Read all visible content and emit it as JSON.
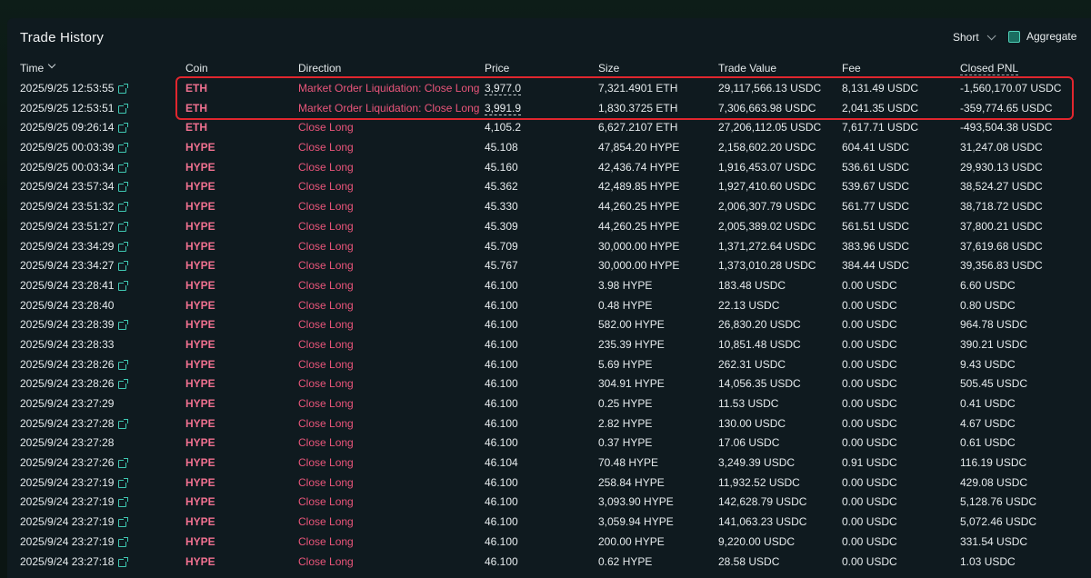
{
  "panel": {
    "title": "Trade History",
    "short_label": "Short",
    "aggregate_label": "Aggregate"
  },
  "columns": {
    "time": "Time",
    "coin": "Coin",
    "direction": "Direction",
    "price": "Price",
    "size": "Size",
    "trade_value": "Trade Value",
    "fee": "Fee",
    "closed_pnl": "Closed PNL"
  },
  "colors": {
    "accent": "#3fc8b2",
    "coin_text": "#f07190",
    "direction_text": "#e9557a",
    "highlight_border": "#e1262e"
  },
  "rows": [
    {
      "time": "2025/9/25 12:53:55",
      "link": true,
      "coin": "ETH",
      "direction": "Market Order Liquidation: Close Long",
      "price": "3,977.0",
      "size": "7,321.4901 ETH",
      "trade_value": "29,117,566.13 USDC",
      "fee": "8,131.49 USDC",
      "pnl": "-1,560,170.07 USDC"
    },
    {
      "time": "2025/9/25 12:53:51",
      "link": true,
      "coin": "ETH",
      "direction": "Market Order Liquidation: Close Long",
      "price": "3,991.9",
      "size": "1,830.3725 ETH",
      "trade_value": "7,306,663.98 USDC",
      "fee": "2,041.35 USDC",
      "pnl": "-359,774.65 USDC"
    },
    {
      "time": "2025/9/25 09:26:14",
      "link": true,
      "coin": "ETH",
      "direction": "Close Long",
      "price": "4,105.2",
      "size": "6,627.2107 ETH",
      "trade_value": "27,206,112.05 USDC",
      "fee": "7,617.71 USDC",
      "pnl": "-493,504.38 USDC"
    },
    {
      "time": "2025/9/25 00:03:39",
      "link": true,
      "coin": "HYPE",
      "direction": "Close Long",
      "price": "45.108",
      "size": "47,854.20 HYPE",
      "trade_value": "2,158,602.20 USDC",
      "fee": "604.41 USDC",
      "pnl": "31,247.08 USDC"
    },
    {
      "time": "2025/9/25 00:03:34",
      "link": true,
      "coin": "HYPE",
      "direction": "Close Long",
      "price": "45.160",
      "size": "42,436.74 HYPE",
      "trade_value": "1,916,453.07 USDC",
      "fee": "536.61 USDC",
      "pnl": "29,930.13 USDC"
    },
    {
      "time": "2025/9/24 23:57:34",
      "link": true,
      "coin": "HYPE",
      "direction": "Close Long",
      "price": "45.362",
      "size": "42,489.85 HYPE",
      "trade_value": "1,927,410.60 USDC",
      "fee": "539.67 USDC",
      "pnl": "38,524.27 USDC"
    },
    {
      "time": "2025/9/24 23:51:32",
      "link": true,
      "coin": "HYPE",
      "direction": "Close Long",
      "price": "45.330",
      "size": "44,260.25 HYPE",
      "trade_value": "2,006,307.79 USDC",
      "fee": "561.77 USDC",
      "pnl": "38,718.72 USDC"
    },
    {
      "time": "2025/9/24 23:51:27",
      "link": true,
      "coin": "HYPE",
      "direction": "Close Long",
      "price": "45.309",
      "size": "44,260.25 HYPE",
      "trade_value": "2,005,389.02 USDC",
      "fee": "561.51 USDC",
      "pnl": "37,800.21 USDC"
    },
    {
      "time": "2025/9/24 23:34:29",
      "link": true,
      "coin": "HYPE",
      "direction": "Close Long",
      "price": "45.709",
      "size": "30,000.00 HYPE",
      "trade_value": "1,371,272.64 USDC",
      "fee": "383.96 USDC",
      "pnl": "37,619.68 USDC"
    },
    {
      "time": "2025/9/24 23:34:27",
      "link": true,
      "coin": "HYPE",
      "direction": "Close Long",
      "price": "45.767",
      "size": "30,000.00 HYPE",
      "trade_value": "1,373,010.28 USDC",
      "fee": "384.44 USDC",
      "pnl": "39,356.83 USDC"
    },
    {
      "time": "2025/9/24 23:28:41",
      "link": true,
      "coin": "HYPE",
      "direction": "Close Long",
      "price": "46.100",
      "size": "3.98 HYPE",
      "trade_value": "183.48 USDC",
      "fee": "0.00 USDC",
      "pnl": "6.60 USDC"
    },
    {
      "time": "2025/9/24 23:28:40",
      "link": false,
      "coin": "HYPE",
      "direction": "Close Long",
      "price": "46.100",
      "size": "0.48 HYPE",
      "trade_value": "22.13 USDC",
      "fee": "0.00 USDC",
      "pnl": "0.80 USDC"
    },
    {
      "time": "2025/9/24 23:28:39",
      "link": true,
      "coin": "HYPE",
      "direction": "Close Long",
      "price": "46.100",
      "size": "582.00 HYPE",
      "trade_value": "26,830.20 USDC",
      "fee": "0.00 USDC",
      "pnl": "964.78 USDC"
    },
    {
      "time": "2025/9/24 23:28:33",
      "link": false,
      "coin": "HYPE",
      "direction": "Close Long",
      "price": "46.100",
      "size": "235.39 HYPE",
      "trade_value": "10,851.48 USDC",
      "fee": "0.00 USDC",
      "pnl": "390.21 USDC"
    },
    {
      "time": "2025/9/24 23:28:26",
      "link": true,
      "coin": "HYPE",
      "direction": "Close Long",
      "price": "46.100",
      "size": "5.69 HYPE",
      "trade_value": "262.31 USDC",
      "fee": "0.00 USDC",
      "pnl": "9.43 USDC"
    },
    {
      "time": "2025/9/24 23:28:26",
      "link": true,
      "coin": "HYPE",
      "direction": "Close Long",
      "price": "46.100",
      "size": "304.91 HYPE",
      "trade_value": "14,056.35 USDC",
      "fee": "0.00 USDC",
      "pnl": "505.45 USDC"
    },
    {
      "time": "2025/9/24 23:27:29",
      "link": false,
      "coin": "HYPE",
      "direction": "Close Long",
      "price": "46.100",
      "size": "0.25 HYPE",
      "trade_value": "11.53 USDC",
      "fee": "0.00 USDC",
      "pnl": "0.41 USDC"
    },
    {
      "time": "2025/9/24 23:27:28",
      "link": true,
      "coin": "HYPE",
      "direction": "Close Long",
      "price": "46.100",
      "size": "2.82 HYPE",
      "trade_value": "130.00 USDC",
      "fee": "0.00 USDC",
      "pnl": "4.67 USDC"
    },
    {
      "time": "2025/9/24 23:27:28",
      "link": false,
      "coin": "HYPE",
      "direction": "Close Long",
      "price": "46.100",
      "size": "0.37 HYPE",
      "trade_value": "17.06 USDC",
      "fee": "0.00 USDC",
      "pnl": "0.61 USDC"
    },
    {
      "time": "2025/9/24 23:27:26",
      "link": true,
      "coin": "HYPE",
      "direction": "Close Long",
      "price": "46.104",
      "size": "70.48 HYPE",
      "trade_value": "3,249.39 USDC",
      "fee": "0.91 USDC",
      "pnl": "116.19 USDC"
    },
    {
      "time": "2025/9/24 23:27:19",
      "link": true,
      "coin": "HYPE",
      "direction": "Close Long",
      "price": "46.100",
      "size": "258.84 HYPE",
      "trade_value": "11,932.52 USDC",
      "fee": "0.00 USDC",
      "pnl": "429.08 USDC"
    },
    {
      "time": "2025/9/24 23:27:19",
      "link": true,
      "coin": "HYPE",
      "direction": "Close Long",
      "price": "46.100",
      "size": "3,093.90 HYPE",
      "trade_value": "142,628.79 USDC",
      "fee": "0.00 USDC",
      "pnl": "5,128.76 USDC"
    },
    {
      "time": "2025/9/24 23:27:19",
      "link": true,
      "coin": "HYPE",
      "direction": "Close Long",
      "price": "46.100",
      "size": "3,059.94 HYPE",
      "trade_value": "141,063.23 USDC",
      "fee": "0.00 USDC",
      "pnl": "5,072.46 USDC"
    },
    {
      "time": "2025/9/24 23:27:19",
      "link": true,
      "coin": "HYPE",
      "direction": "Close Long",
      "price": "46.100",
      "size": "200.00 HYPE",
      "trade_value": "9,220.00 USDC",
      "fee": "0.00 USDC",
      "pnl": "331.54 USDC"
    },
    {
      "time": "2025/9/24 23:27:18",
      "link": true,
      "coin": "HYPE",
      "direction": "Close Long",
      "price": "46.100",
      "size": "0.62 HYPE",
      "trade_value": "28.58 USDC",
      "fee": "0.00 USDC",
      "pnl": "1.03 USDC"
    }
  ]
}
